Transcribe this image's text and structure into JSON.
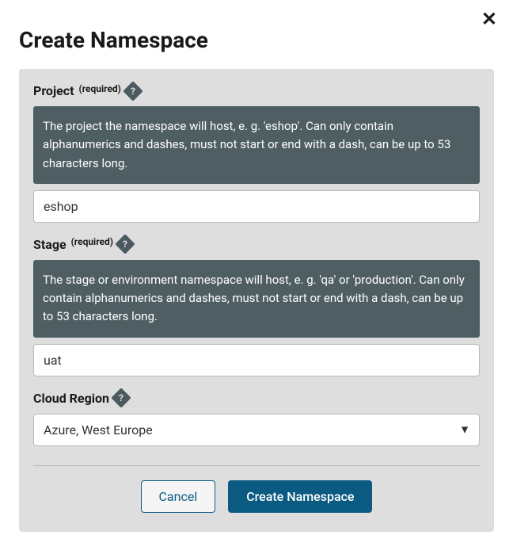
{
  "modal": {
    "title": "Create Namespace",
    "close_label": "✕"
  },
  "fields": {
    "project": {
      "label": "Project",
      "required": "(required)",
      "help": "The project the namespace will host, e. g. 'eshop'. Can only contain alphanumerics and dashes, must not start or end with a dash, can be up to 53 characters long.",
      "value": "eshop"
    },
    "stage": {
      "label": "Stage",
      "required": "(required)",
      "help": "The stage or environment namespace will host, e. g. 'qa' or 'production'. Can only contain alphanumerics and dashes, must not start or end with a dash, can be up to 53 characters long.",
      "value": "uat"
    },
    "cloud_region": {
      "label": "Cloud Region",
      "selected": "Azure, West Europe"
    }
  },
  "buttons": {
    "cancel": "Cancel",
    "submit": "Create Namespace"
  },
  "icons": {
    "help": "?"
  }
}
